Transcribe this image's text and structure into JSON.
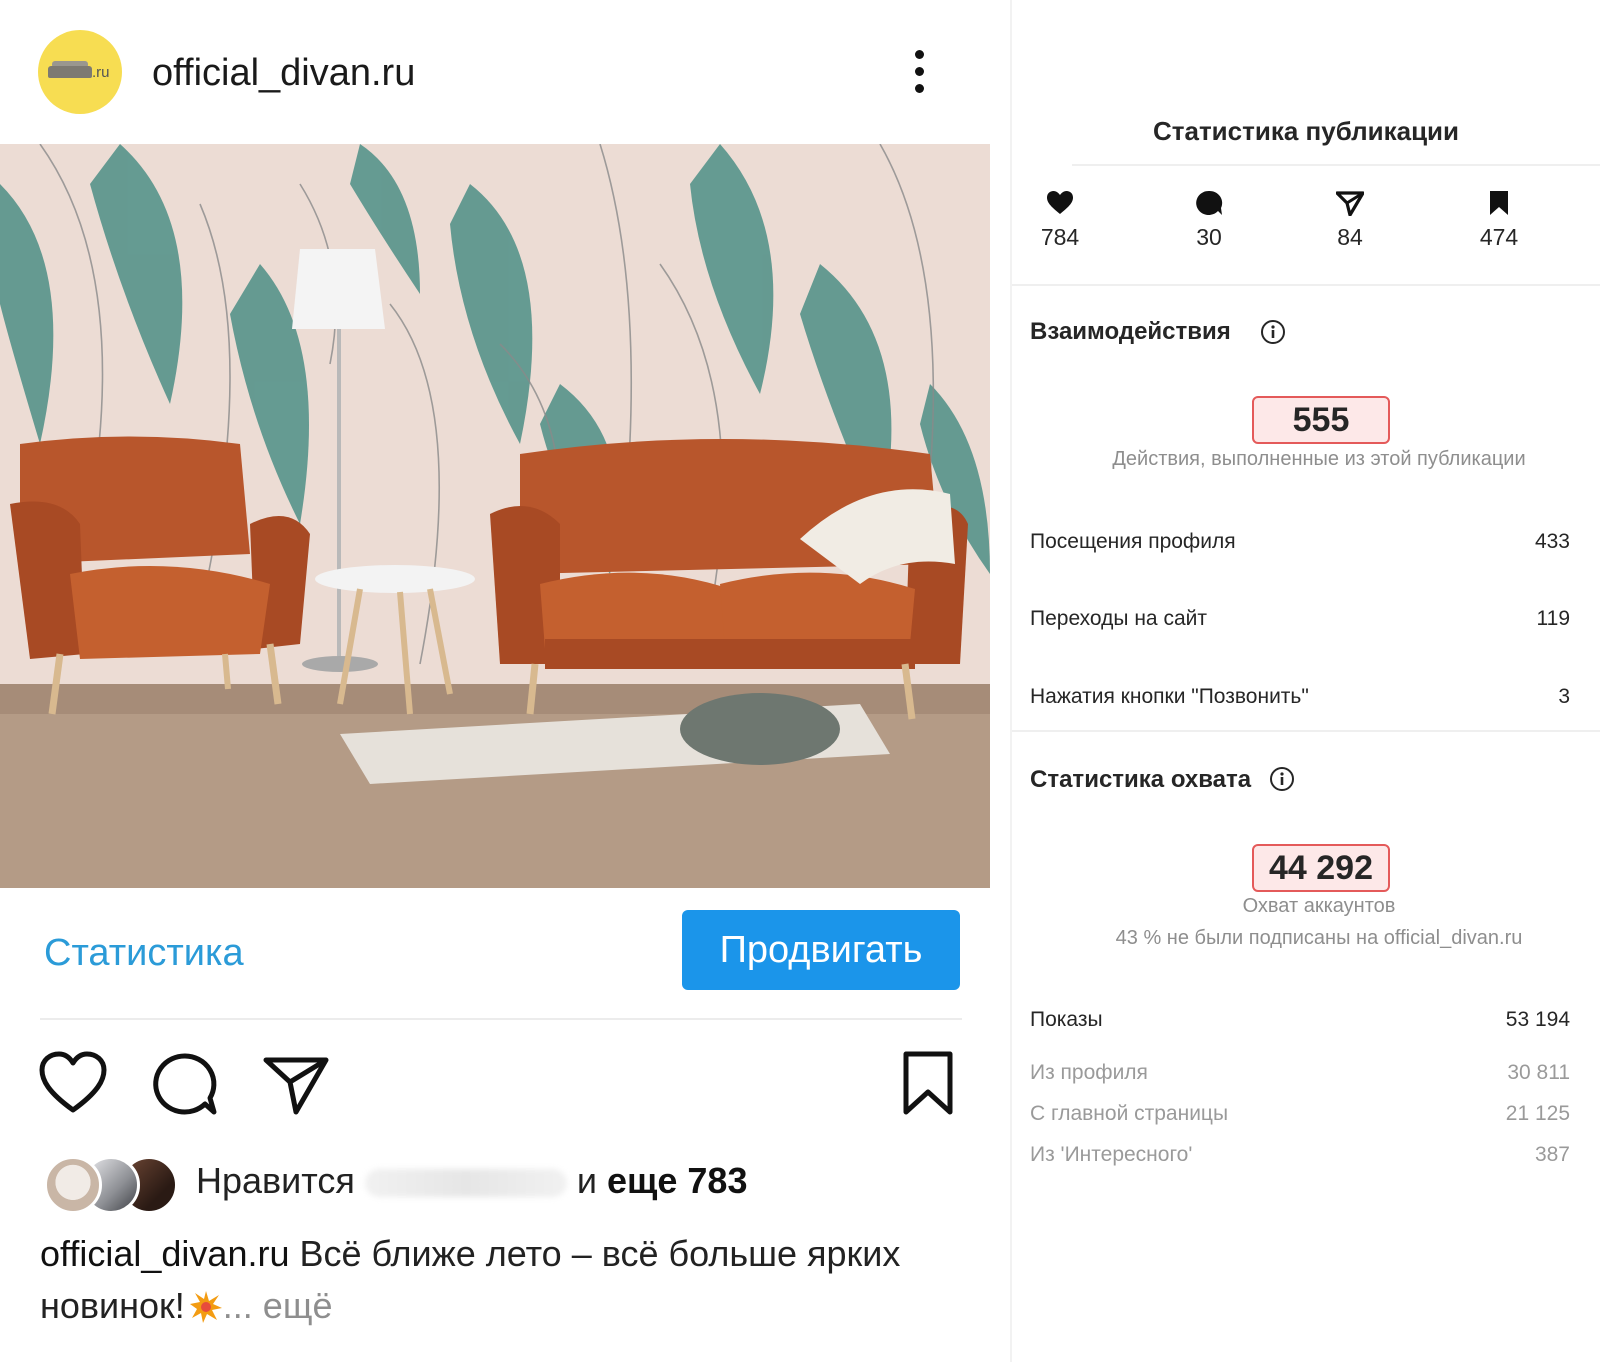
{
  "post": {
    "username": "official_divan.ru",
    "avatar_text": ".ru",
    "stats_link": "Статистика",
    "promote_button": "Продвигать",
    "likes": {
      "prefix": "Нравится",
      "suffix_pre": "и ",
      "suffix_bold": "еще 783"
    },
    "caption": {
      "user": "official_divan.ru",
      "text": " Всё ближе лето – всё больше ярких новинок!",
      "more": "... ещё"
    }
  },
  "insights": {
    "title": "Статистика публикации",
    "metrics": {
      "likes": "784",
      "comments": "30",
      "shares": "84",
      "saves": "474"
    },
    "interactions": {
      "title": "Взаимодействия",
      "total": "555",
      "subtitle": "Действия, выполненные из этой публикации",
      "rows": [
        {
          "label": "Посещения профиля",
          "value": "433"
        },
        {
          "label": "Переходы на сайт",
          "value": "119"
        },
        {
          "label": "Нажатия кнопки \"Позвонить\"",
          "value": "3"
        }
      ]
    },
    "reach": {
      "title": "Статистика охвата",
      "total": "44 292",
      "subtitle": "Охват аккаунтов",
      "note": "43 % не были подписаны на official_divan.ru",
      "impressions_label": "Показы",
      "impressions_value": "53 194",
      "rows": [
        {
          "label": "Из профиля",
          "value": "30 811"
        },
        {
          "label": "С главной страницы",
          "value": "21 125"
        },
        {
          "label": "Из 'Интересного'",
          "value": "387"
        }
      ]
    }
  },
  "colors": {
    "accent_blue": "#1b95ea",
    "link_blue": "#2b9bd8",
    "highlight_red": "#e45a5a",
    "sofa_orange": "#b8562c"
  }
}
